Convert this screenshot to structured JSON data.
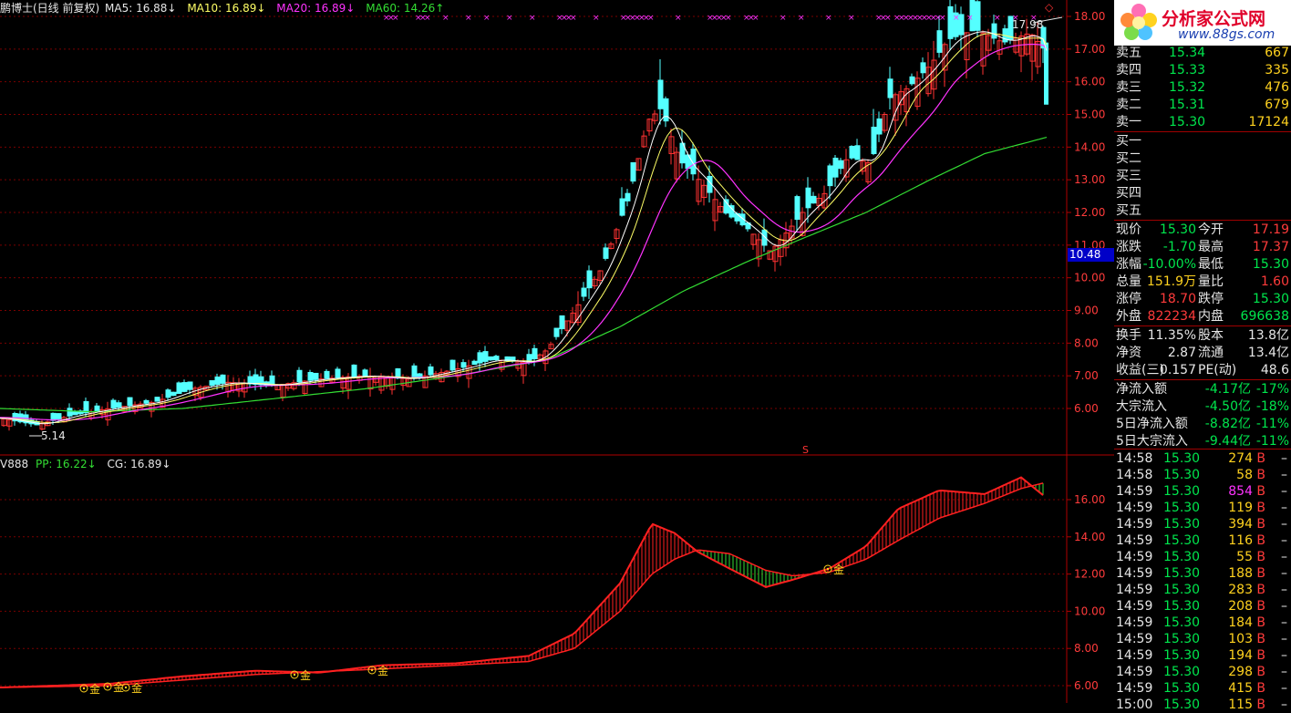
{
  "main_header": {
    "title": "鹏博士(日线 前复权)",
    "ma5": "MA5: 16.88↓",
    "ma10": "MA10: 16.89↓",
    "ma20": "MA20: 16.89↓",
    "ma60": "MA60: 14.26↑",
    "colors": {
      "title": "#e6e6e6",
      "ma5": "#e6e6e6",
      "ma10": "#ffff66",
      "ma20": "#ff33ff",
      "ma60": "#33dd33"
    }
  },
  "sub_header": {
    "title": "V888",
    "pp": "PP: 16.22↓",
    "cg": "CG: 16.89↓"
  },
  "annotations": {
    "high": "17.98",
    "low": "5.14",
    "cursor_price": "10.48",
    "s_marker": "S",
    "gold": "金",
    "diamond": "◇"
  },
  "right_axis_main": [
    "18.00",
    "17.00",
    "16.00",
    "15.00",
    "14.00",
    "13.00",
    "12.00",
    "11.00",
    "10.00",
    "9.00",
    "8.00",
    "7.00",
    "6.00"
  ],
  "right_axis_sub": [
    "16.00",
    "14.00",
    "12.00",
    "10.00",
    "8.00",
    "6.00"
  ],
  "logo": {
    "name": "分析家公式网",
    "url": "www.88gs.com"
  },
  "order_book": {
    "sells": [
      {
        "label": "卖五",
        "price": "15.34",
        "vol": "667"
      },
      {
        "label": "卖四",
        "price": "15.33",
        "vol": "335"
      },
      {
        "label": "卖三",
        "price": "15.32",
        "vol": "476"
      },
      {
        "label": "卖二",
        "price": "15.31",
        "vol": "679"
      },
      {
        "label": "卖一",
        "price": "15.30",
        "vol": "17124"
      }
    ],
    "buys": [
      {
        "label": "买一"
      },
      {
        "label": "买二"
      },
      {
        "label": "买三"
      },
      {
        "label": "买四"
      },
      {
        "label": "买五"
      }
    ]
  },
  "quote": [
    {
      "l1": "现价",
      "v1": "15.30",
      "c1": "gr",
      "l2": "今开",
      "v2": "17.19",
      "c2": "rd"
    },
    {
      "l1": "涨跌",
      "v1": "-1.70",
      "c1": "gr",
      "l2": "最高",
      "v2": "17.37",
      "c2": "rd"
    },
    {
      "l1": "涨幅",
      "v1": "-10.00%",
      "c1": "gr",
      "l2": "最低",
      "v2": "15.30",
      "c2": "gr"
    },
    {
      "l1": "总量",
      "v1": "151.9万",
      "c1": "yl",
      "l2": "量比",
      "v2": "1.60",
      "c2": "rd"
    },
    {
      "l1": "涨停",
      "v1": "18.70",
      "c1": "rd",
      "l2": "跌停",
      "v2": "15.30",
      "c2": "gr"
    },
    {
      "l1": "外盘",
      "v1": "822234",
      "c1": "rd",
      "l2": "内盘",
      "v2": "696638",
      "c2": "gr"
    }
  ],
  "stats": [
    {
      "l1": "换手",
      "v1": "11.35%",
      "l2": "股本",
      "v2": "13.8亿"
    },
    {
      "l1": "净资",
      "v1": "2.87",
      "l2": "流通",
      "v2": "13.4亿"
    },
    {
      "l1": "收益(三)",
      "v1": "0.157",
      "l2": "PE(动)",
      "v2": "48.6"
    }
  ],
  "flows": [
    {
      "label": "净流入额",
      "value": "-4.17亿",
      "pct": "-17%"
    },
    {
      "label": "大宗流入",
      "value": "-4.50亿",
      "pct": "-18%"
    },
    {
      "label": "5日净流入额",
      "value": "-8.82亿",
      "pct": "-11%"
    },
    {
      "label": "5日大宗流入",
      "value": "-9.44亿",
      "pct": "-11%"
    }
  ],
  "ticks": [
    {
      "time": "14:58",
      "price": "15.30",
      "vol": "274",
      "side": "B",
      "vc": "yl"
    },
    {
      "time": "14:58",
      "price": "15.30",
      "vol": "58",
      "side": "B",
      "vc": "yl"
    },
    {
      "time": "14:59",
      "price": "15.30",
      "vol": "854",
      "side": "B",
      "vc": "mg"
    },
    {
      "time": "14:59",
      "price": "15.30",
      "vol": "119",
      "side": "B",
      "vc": "yl"
    },
    {
      "time": "14:59",
      "price": "15.30",
      "vol": "394",
      "side": "B",
      "vc": "yl"
    },
    {
      "time": "14:59",
      "price": "15.30",
      "vol": "116",
      "side": "B",
      "vc": "yl"
    },
    {
      "time": "14:59",
      "price": "15.30",
      "vol": "55",
      "side": "B",
      "vc": "yl"
    },
    {
      "time": "14:59",
      "price": "15.30",
      "vol": "188",
      "side": "B",
      "vc": "yl"
    },
    {
      "time": "14:59",
      "price": "15.30",
      "vol": "283",
      "side": "B",
      "vc": "yl"
    },
    {
      "time": "14:59",
      "price": "15.30",
      "vol": "208",
      "side": "B",
      "vc": "yl"
    },
    {
      "time": "14:59",
      "price": "15.30",
      "vol": "184",
      "side": "B",
      "vc": "yl"
    },
    {
      "time": "14:59",
      "price": "15.30",
      "vol": "103",
      "side": "B",
      "vc": "yl"
    },
    {
      "time": "14:59",
      "price": "15.30",
      "vol": "194",
      "side": "B",
      "vc": "yl"
    },
    {
      "time": "14:59",
      "price": "15.30",
      "vol": "298",
      "side": "B",
      "vc": "yl"
    },
    {
      "time": "14:59",
      "price": "15.30",
      "vol": "415",
      "side": "B",
      "vc": "yl"
    },
    {
      "time": "15:00",
      "price": "15.30",
      "vol": "115",
      "side": "B",
      "vc": "yl"
    }
  ],
  "chart_data": {
    "type": "line",
    "price_range": [
      5.0,
      18.2
    ],
    "ma_last": {
      "MA5": 16.88,
      "MA10": 16.89,
      "MA20": 16.89,
      "MA60": 14.26
    },
    "close_path": [
      [
        0,
        5.7
      ],
      [
        40,
        5.5
      ],
      [
        80,
        5.8
      ],
      [
        120,
        6.0
      ],
      [
        170,
        6.2
      ],
      [
        210,
        6.6
      ],
      [
        250,
        6.8
      ],
      [
        300,
        6.7
      ],
      [
        350,
        6.9
      ],
      [
        400,
        7.0
      ],
      [
        450,
        6.9
      ],
      [
        500,
        7.2
      ],
      [
        540,
        7.5
      ],
      [
        580,
        7.4
      ],
      [
        600,
        7.8
      ],
      [
        630,
        9.0
      ],
      [
        660,
        10.3
      ],
      [
        690,
        12.5
      ],
      [
        710,
        14.8
      ],
      [
        725,
        15.2
      ],
      [
        745,
        13.6
      ],
      [
        770,
        12.9
      ],
      [
        795,
        12.0
      ],
      [
        820,
        11.5
      ],
      [
        845,
        10.8
      ],
      [
        860,
        11.3
      ],
      [
        880,
        12.0
      ],
      [
        905,
        12.6
      ],
      [
        930,
        13.7
      ],
      [
        955,
        13.5
      ],
      [
        975,
        15.5
      ],
      [
        995,
        15.8
      ],
      [
        1020,
        16.5
      ],
      [
        1040,
        17.3
      ],
      [
        1070,
        17.6
      ],
      [
        1100,
        17.2
      ],
      [
        1130,
        17.5
      ],
      [
        1145,
        17.0
      ],
      [
        1148,
        15.3
      ]
    ],
    "ma60_path": [
      [
        0,
        6.0
      ],
      [
        100,
        5.9
      ],
      [
        200,
        6.0
      ],
      [
        300,
        6.3
      ],
      [
        400,
        6.6
      ],
      [
        500,
        7.0
      ],
      [
        600,
        7.5
      ],
      [
        680,
        8.5
      ],
      [
        750,
        9.6
      ],
      [
        820,
        10.5
      ],
      [
        880,
        11.2
      ],
      [
        950,
        12.0
      ],
      [
        1020,
        13.0
      ],
      [
        1080,
        13.8
      ],
      [
        1148,
        14.3
      ]
    ],
    "pp_path": [
      [
        0,
        5.9
      ],
      [
        60,
        6.0
      ],
      [
        120,
        6.1
      ],
      [
        200,
        6.5
      ],
      [
        280,
        6.8
      ],
      [
        350,
        6.7
      ],
      [
        420,
        7.1
      ],
      [
        500,
        7.2
      ],
      [
        580,
        7.6
      ],
      [
        630,
        8.8
      ],
      [
        680,
        11.5
      ],
      [
        715,
        14.7
      ],
      [
        740,
        14.2
      ],
      [
        765,
        13.2
      ],
      [
        800,
        12.3
      ],
      [
        840,
        11.3
      ],
      [
        870,
        11.7
      ],
      [
        910,
        12.3
      ],
      [
        950,
        13.5
      ],
      [
        985,
        15.5
      ],
      [
        1030,
        16.5
      ],
      [
        1080,
        16.3
      ],
      [
        1120,
        17.2
      ],
      [
        1145,
        16.2
      ]
    ],
    "cg_path": [
      [
        0,
        5.9
      ],
      [
        60,
        5.95
      ],
      [
        120,
        6.0
      ],
      [
        200,
        6.3
      ],
      [
        280,
        6.6
      ],
      [
        350,
        6.75
      ],
      [
        420,
        6.9
      ],
      [
        500,
        7.1
      ],
      [
        580,
        7.3
      ],
      [
        630,
        8.0
      ],
      [
        680,
        10.0
      ],
      [
        715,
        12.0
      ],
      [
        740,
        12.8
      ],
      [
        765,
        13.3
      ],
      [
        800,
        13.1
      ],
      [
        840,
        12.2
      ],
      [
        870,
        11.9
      ],
      [
        910,
        12.1
      ],
      [
        950,
        12.8
      ],
      [
        985,
        13.8
      ],
      [
        1030,
        15.0
      ],
      [
        1080,
        15.8
      ],
      [
        1120,
        16.6
      ],
      [
        1145,
        16.9
      ]
    ]
  }
}
